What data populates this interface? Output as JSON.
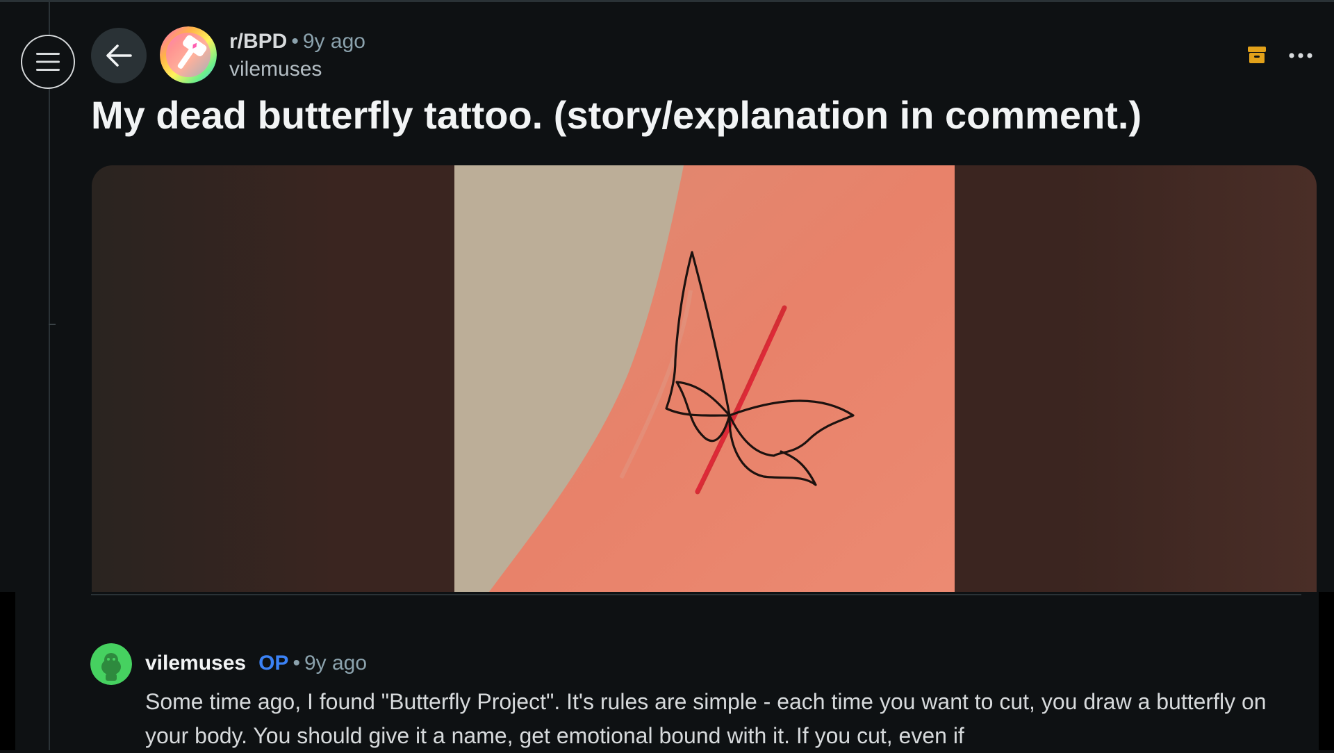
{
  "post": {
    "subreddit": "r/BPD",
    "separator": "•",
    "age": "9y ago",
    "author": "vilemuses",
    "title": "My dead butterfly tattoo. (story/explanation in comment.)"
  },
  "icons": {
    "menu": "menu-icon",
    "back": "arrow-left-icon",
    "archive": "archive-icon",
    "more": "more-horizontal-icon"
  },
  "colors": {
    "background": "#0e1113",
    "archive_accent": "#e3a21a",
    "op_badge": "#3b82f6"
  },
  "comment": {
    "author": "vilemuses",
    "badge": "OP",
    "separator": "•",
    "age": "9y ago",
    "text": "Some time ago, I found \"Butterfly Project\". It's rules are simple - each time you want to cut, you draw a butterfly on your body. You should give it a name, get emotional bound with it. If you cut, even if"
  }
}
